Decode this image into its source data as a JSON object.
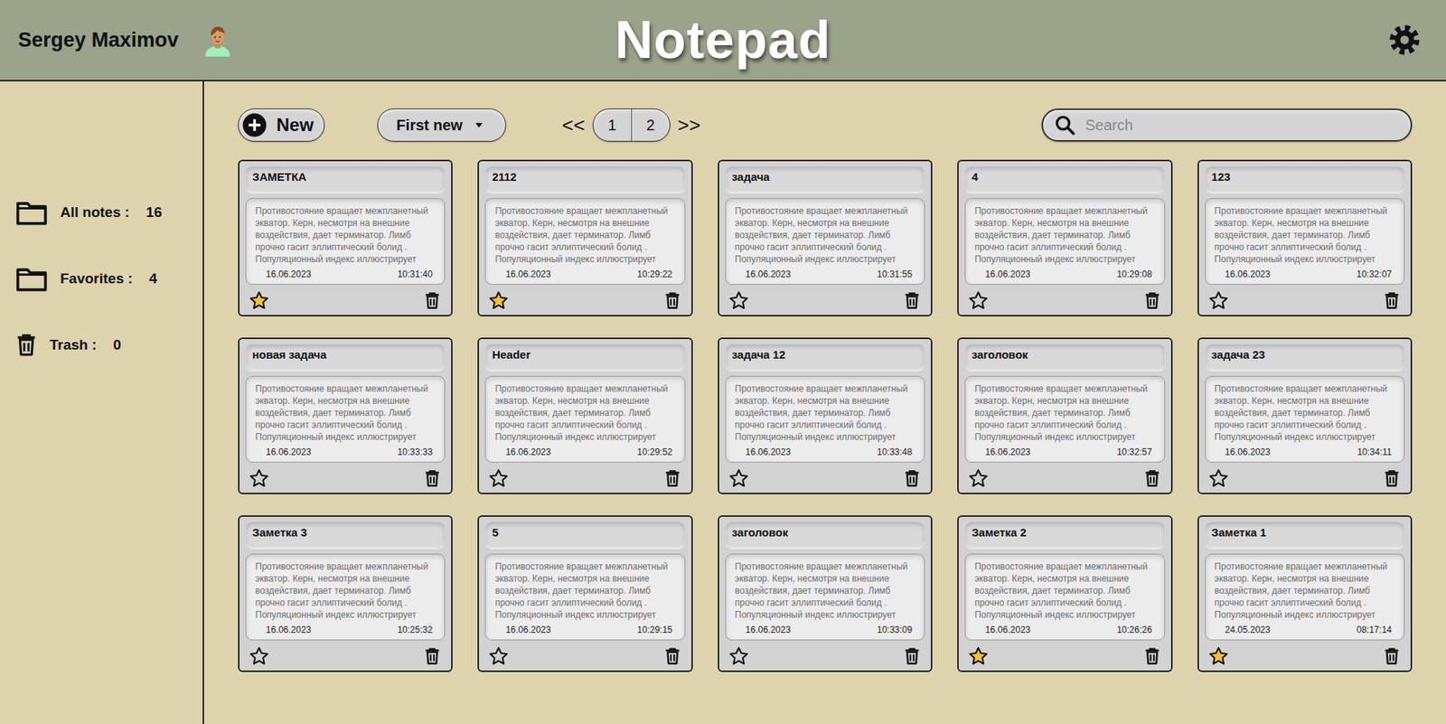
{
  "header": {
    "user": "Sergey Maximov",
    "title": "Notepad"
  },
  "sidebar": {
    "items": [
      {
        "label": "All notes :",
        "count": "16",
        "kind": "folder"
      },
      {
        "label": "Favorites :",
        "count": "4",
        "kind": "folder"
      },
      {
        "label": "Trash :",
        "count": "0",
        "kind": "trash"
      }
    ]
  },
  "toolbar": {
    "new_button": "New",
    "sort": "First new",
    "pagination": {
      "prev": "<<",
      "pages": [
        "1",
        "2"
      ],
      "next": ">>"
    },
    "search": {
      "placeholder": "Search"
    }
  },
  "notes": [
    {
      "title": "ЗАМЕТКА",
      "body": "Противостояние вращает межпланетный экватор. Керн, несмотря на внешние воздействия, дает терминатор. Лимб прочно гасит эллиптический болид . Популяционный индекс иллюстрирует",
      "date": "16.06.2023",
      "time": "10:31:40",
      "favorite": true
    },
    {
      "title": "2112",
      "body": "Противостояние вращает межпланетный экватор. Керн, несмотря на внешние воздействия, дает терминатор. Лимб прочно гасит эллиптический болид . Популяционный индекс иллюстрирует",
      "date": "16.06.2023",
      "time": "10:29:22",
      "favorite": true
    },
    {
      "title": "задача",
      "body": "Противостояние вращает межпланетный экватор. Керн, несмотря на внешние воздействия, дает терминатор. Лимб прочно гасит эллиптический болид . Популяционный индекс иллюстрирует",
      "date": "16.06.2023",
      "time": "10:31:55",
      "favorite": false
    },
    {
      "title": "4",
      "body": "Противостояние вращает межпланетный экватор. Керн, несмотря на внешние воздействия, дает терминатор. Лимб прочно гасит эллиптический болид . Популяционный индекс иллюстрирует",
      "date": "16.06.2023",
      "time": "10:29:08",
      "favorite": false
    },
    {
      "title": "123",
      "body": "Противостояние вращает межпланетный экватор. Керн, несмотря на внешние воздействия, дает терминатор. Лимб прочно гасит эллиптический болид . Популяционный индекс иллюстрирует",
      "date": "16.06.2023",
      "time": "10:32:07",
      "favorite": false
    },
    {
      "title": "новая задача",
      "body": "Противостояние вращает межпланетный экватор. Керн, несмотря на внешние воздействия, дает терминатор. Лимб прочно гасит эллиптический болид . Популяционный индекс иллюстрирует",
      "date": "16.06.2023",
      "time": "10:33:33",
      "favorite": false
    },
    {
      "title": "Header",
      "body": "Противостояние вращает межпланетный экватор. Керн, несмотря на внешние воздействия, дает терминатор. Лимб прочно гасит эллиптический болид . Популяционный индекс иллюстрирует",
      "date": "16.06.2023",
      "time": "10:29:52",
      "favorite": false
    },
    {
      "title": "задача 12",
      "body": "Противостояние вращает межпланетный экватор. Керн, несмотря на внешние воздействия, дает терминатор. Лимб прочно гасит эллиптический болид . Популяционный индекс иллюстрирует",
      "date": "16.06.2023",
      "time": "10:33:48",
      "favorite": false
    },
    {
      "title": "заголовок",
      "body": "Противостояние вращает межпланетный экватор. Керн, несмотря на внешние воздействия, дает терминатор. Лимб прочно гасит эллиптический болид . Популяционный индекс иллюстрирует",
      "date": "16.06.2023",
      "time": "10:32:57",
      "favorite": false
    },
    {
      "title": "задача 23",
      "body": "Противостояние вращает межпланетный экватор. Керн, несмотря на внешние воздействия, дает терминатор. Лимб прочно гасит эллиптический болид . Популяционный индекс иллюстрирует",
      "date": "16.06.2023",
      "time": "10:34:11",
      "favorite": false
    },
    {
      "title": "Заметка 3",
      "body": "Противостояние вращает межпланетный экватор. Керн, несмотря на внешние воздействия, дает терминатор. Лимб прочно гасит эллиптический болид . Популяционный индекс иллюстрирует",
      "date": "16.06.2023",
      "time": "10:25:32",
      "favorite": false
    },
    {
      "title": "5",
      "body": "Противостояние вращает межпланетный экватор. Керн, несмотря на внешние воздействия, дает терминатор. Лимб прочно гасит эллиптический болид . Популяционный индекс иллюстрирует",
      "date": "16.06.2023",
      "time": "10:29:15",
      "favorite": false
    },
    {
      "title": "заголовок",
      "body": "Противостояние вращает межпланетный экватор. Керн, несмотря на внешние воздействия, дает терминатор. Лимб прочно гасит эллиптический болид . Популяционный индекс иллюстрирует",
      "date": "16.06.2023",
      "time": "10:33:09",
      "favorite": false
    },
    {
      "title": "Заметка 2",
      "body": "Противостояние вращает межпланетный экватор. Керн, несмотря на внешние воздействия, дает терминатор. Лимб прочно гасит эллиптический болид . Популяционный индекс иллюстрирует",
      "date": "16.06.2023",
      "time": "10:26:26",
      "favorite": true
    },
    {
      "title": "Заметка 1",
      "body": "Противостояние вращает межпланетный экватор. Керн, несмотря на внешние воздействия, дает терминатор. Лимб прочно гасит эллиптический болид . Популяционный индекс иллюстрирует",
      "date": "24.05.2023",
      "time": "08:17:14",
      "favorite": true
    }
  ]
}
